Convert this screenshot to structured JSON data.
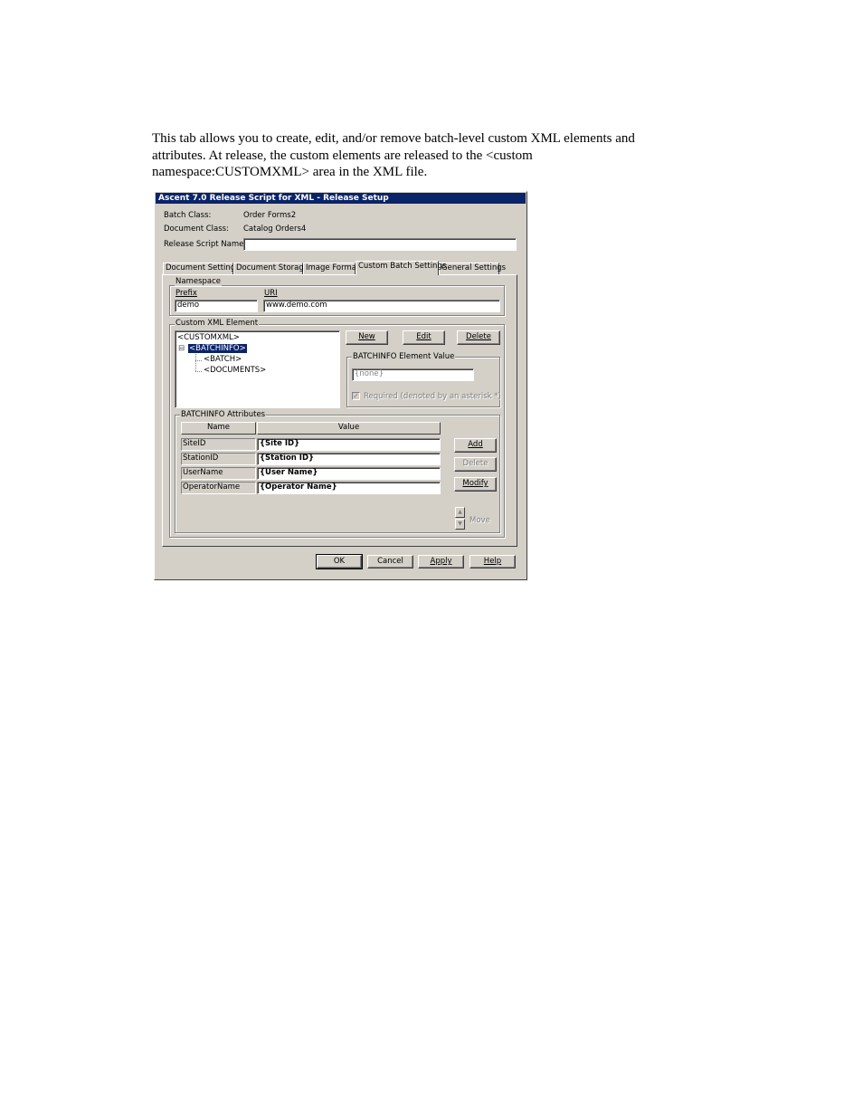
{
  "paragraph": {
    "line1": "This tab allows you to create, edit, and/or remove batch-level custom XML elements and",
    "line2": "attributes. At release, the custom elements are released to the <custom",
    "line3": "namespace:CUSTOMXML> area in the XML file."
  },
  "dialog": {
    "title": "Ascent 7.0 Release Script for XML - Release Setup",
    "batch_class_label": "Batch Class:",
    "batch_class_value": "Order Forms2",
    "document_class_label": "Document Class:",
    "document_class_value": "Catalog Orders4",
    "release_script_name_label": "Release Script Name:",
    "release_script_name_value": "",
    "tabs": [
      "Document Settings",
      "Document Storage",
      "Image Format",
      "Custom Batch Settings",
      "General Settings"
    ],
    "namespace": {
      "group_label": "Namespace",
      "prefix_label": "Prefix",
      "prefix_value": "demo",
      "uri_label": "URI",
      "uri_value": "www.demo.com"
    },
    "custom_xml": {
      "group_label": "Custom XML Element",
      "tree": [
        "<CUSTOMXML>",
        "<BATCHINFO>",
        "<BATCH>",
        "<DOCUMENTS>"
      ],
      "expand_glyph": "⊟",
      "new_label": "New",
      "edit_label": "Edit",
      "delete_label": "Delete",
      "element_value_group_label": "BATCHINFO Element Value",
      "element_value": "{none}",
      "required_label": "Required (denoted by an asterisk *)"
    },
    "attributes": {
      "group_label": "BATCHINFO Attributes",
      "columns": [
        "Name",
        "Value"
      ],
      "rows": [
        {
          "name": "SiteID",
          "value": "{Site ID}"
        },
        {
          "name": "StationID",
          "value": "{Station ID}"
        },
        {
          "name": "UserName",
          "value": "{User Name}"
        },
        {
          "name": "OperatorName",
          "value": "{Operator Name}"
        }
      ],
      "add_label": "Add",
      "delete_label": "Delete",
      "modify_label": "Modify",
      "move_label": "Move"
    },
    "footer": {
      "ok_label": "OK",
      "cancel_label": "Cancel",
      "apply_label": "Apply",
      "help_label": "Help"
    }
  }
}
